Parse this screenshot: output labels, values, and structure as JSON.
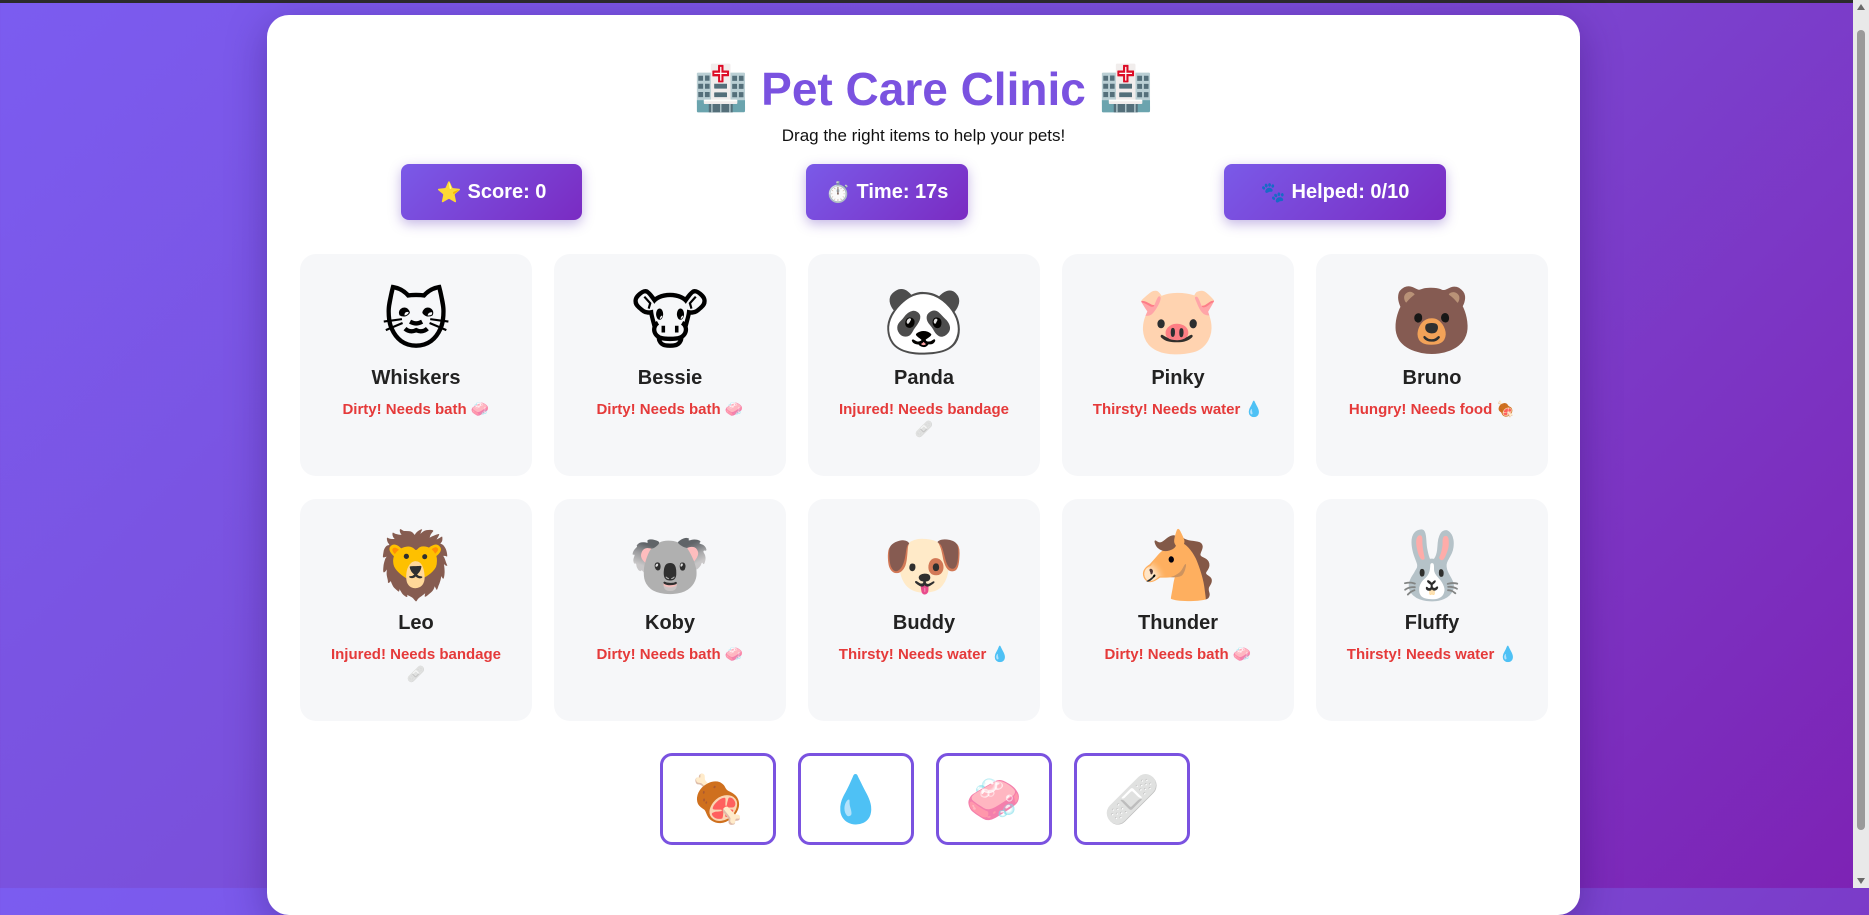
{
  "header": {
    "title": "Pet Care Clinic",
    "title_icon_left": "🏥",
    "title_icon_right": "🏥",
    "subtitle": "Drag the right items to help your pets!"
  },
  "stats": {
    "score": {
      "icon": "⭐",
      "text": "Score: 0"
    },
    "time": {
      "icon": "⏱️",
      "text": "Time: 17s"
    },
    "helped": {
      "icon": "🐾",
      "text": "Helped: 0/10"
    }
  },
  "pets": [
    {
      "emoji": "🐱",
      "name": "Whiskers",
      "need": "Dirty! Needs bath 🧼"
    },
    {
      "emoji": "🐮",
      "name": "Bessie",
      "need": "Dirty! Needs bath 🧼"
    },
    {
      "emoji": "🐼",
      "name": "Panda",
      "need": "Injured! Needs bandage 🩹"
    },
    {
      "emoji": "🐷",
      "name": "Pinky",
      "need": "Thirsty! Needs water 💧"
    },
    {
      "emoji": "🐻",
      "name": "Bruno",
      "need": "Hungry! Needs food 🍖"
    },
    {
      "emoji": "🦁",
      "name": "Leo",
      "need": "Injured! Needs bandage 🩹"
    },
    {
      "emoji": "🐨",
      "name": "Koby",
      "need": "Dirty! Needs bath 🧼"
    },
    {
      "emoji": "🐶",
      "name": "Buddy",
      "need": "Thirsty! Needs water 💧"
    },
    {
      "emoji": "🐴",
      "name": "Thunder",
      "need": "Dirty! Needs bath 🧼"
    },
    {
      "emoji": "🐰",
      "name": "Fluffy",
      "need": "Thirsty! Needs water 💧"
    }
  ],
  "items": [
    {
      "emoji": "🍖",
      "name": "food"
    },
    {
      "emoji": "💧",
      "name": "water"
    },
    {
      "emoji": "🧼",
      "name": "soap"
    },
    {
      "emoji": "🩹",
      "name": "bandage"
    }
  ],
  "colors": {
    "accent": "#7a52e0",
    "need_text": "#e53a3a",
    "card_bg": "#f6f7f9"
  }
}
